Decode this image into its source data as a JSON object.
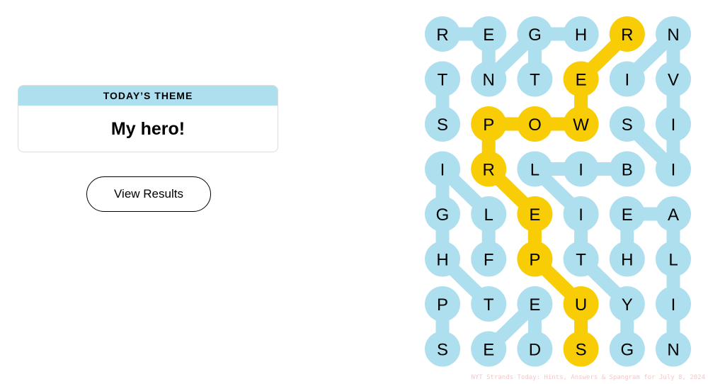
{
  "theme": {
    "label": "TODAY’S THEME",
    "title": "My hero!"
  },
  "buttons": {
    "view_results": "View Results"
  },
  "board": {
    "rows": 8,
    "cols": 6,
    "letters": [
      [
        "R",
        "E",
        "G",
        "H",
        "R",
        "N"
      ],
      [
        "T",
        "N",
        "T",
        "E",
        "I",
        "V"
      ],
      [
        "S",
        "P",
        "O",
        "W",
        "S",
        "I"
      ],
      [
        "I",
        "R",
        "L",
        "I",
        "B",
        "I"
      ],
      [
        "G",
        "L",
        "E",
        "I",
        "E",
        "A"
      ],
      [
        "H",
        "F",
        "P",
        "T",
        "H",
        "L"
      ],
      [
        "P",
        "T",
        "E",
        "U",
        "Y",
        "I"
      ],
      [
        "S",
        "E",
        "D",
        "S",
        "G",
        "N"
      ]
    ],
    "highlighted": [
      [
        0,
        4
      ],
      [
        1,
        3
      ],
      [
        2,
        1
      ],
      [
        2,
        2
      ],
      [
        2,
        3
      ],
      [
        3,
        1
      ],
      [
        4,
        2
      ],
      [
        5,
        2
      ],
      [
        6,
        3
      ],
      [
        7,
        3
      ]
    ],
    "paths": [
      {
        "type": "found",
        "cells": [
          [
            0,
            4
          ],
          [
            1,
            3
          ],
          [
            2,
            3
          ],
          [
            2,
            2
          ],
          [
            2,
            1
          ],
          [
            3,
            1
          ],
          [
            4,
            2
          ],
          [
            5,
            2
          ],
          [
            6,
            3
          ],
          [
            7,
            3
          ]
        ]
      },
      {
        "type": "found",
        "cells": [
          [
            0,
            0
          ],
          [
            0,
            1
          ],
          [
            1,
            1
          ]
        ]
      },
      {
        "type": "found",
        "cells": [
          [
            1,
            1
          ],
          [
            0,
            2
          ],
          [
            1,
            2
          ]
        ]
      },
      {
        "type": "found",
        "cells": [
          [
            0,
            2
          ],
          [
            0,
            3
          ]
        ]
      },
      {
        "type": "found",
        "cells": [
          [
            1,
            4
          ],
          [
            0,
            5
          ],
          [
            1,
            5
          ],
          [
            2,
            5
          ],
          [
            3,
            5
          ]
        ]
      },
      {
        "type": "found",
        "cells": [
          [
            2,
            4
          ],
          [
            3,
            5
          ]
        ]
      },
      {
        "type": "found",
        "cells": [
          [
            1,
            0
          ],
          [
            2,
            0
          ]
        ]
      },
      {
        "type": "found",
        "cells": [
          [
            3,
            0
          ],
          [
            4,
            0
          ],
          [
            5,
            0
          ]
        ]
      },
      {
        "type": "found",
        "cells": [
          [
            3,
            0
          ],
          [
            4,
            1
          ],
          [
            5,
            1
          ]
        ]
      },
      {
        "type": "found",
        "cells": [
          [
            3,
            2
          ],
          [
            3,
            3
          ],
          [
            3,
            4
          ]
        ]
      },
      {
        "type": "found",
        "cells": [
          [
            3,
            2
          ],
          [
            4,
            3
          ],
          [
            5,
            3
          ],
          [
            6,
            4
          ],
          [
            7,
            4
          ]
        ]
      },
      {
        "type": "found",
        "cells": [
          [
            4,
            4
          ],
          [
            4,
            5
          ],
          [
            5,
            5
          ],
          [
            6,
            5
          ],
          [
            7,
            5
          ]
        ]
      },
      {
        "type": "found",
        "cells": [
          [
            4,
            4
          ],
          [
            5,
            4
          ]
        ]
      },
      {
        "type": "found",
        "cells": [
          [
            5,
            0
          ],
          [
            6,
            1
          ]
        ]
      },
      {
        "type": "found",
        "cells": [
          [
            6,
            0
          ],
          [
            7,
            0
          ]
        ]
      },
      {
        "type": "found",
        "cells": [
          [
            7,
            1
          ],
          [
            6,
            2
          ],
          [
            7,
            2
          ]
        ]
      }
    ]
  },
  "colors": {
    "found": "#aedfee",
    "spangram": "#f8cd05",
    "card_header": "#aedfee",
    "text": "#000000"
  },
  "watermark": "NYT Strands Today: Hints, Answers & Spangram for July 8, 2024"
}
